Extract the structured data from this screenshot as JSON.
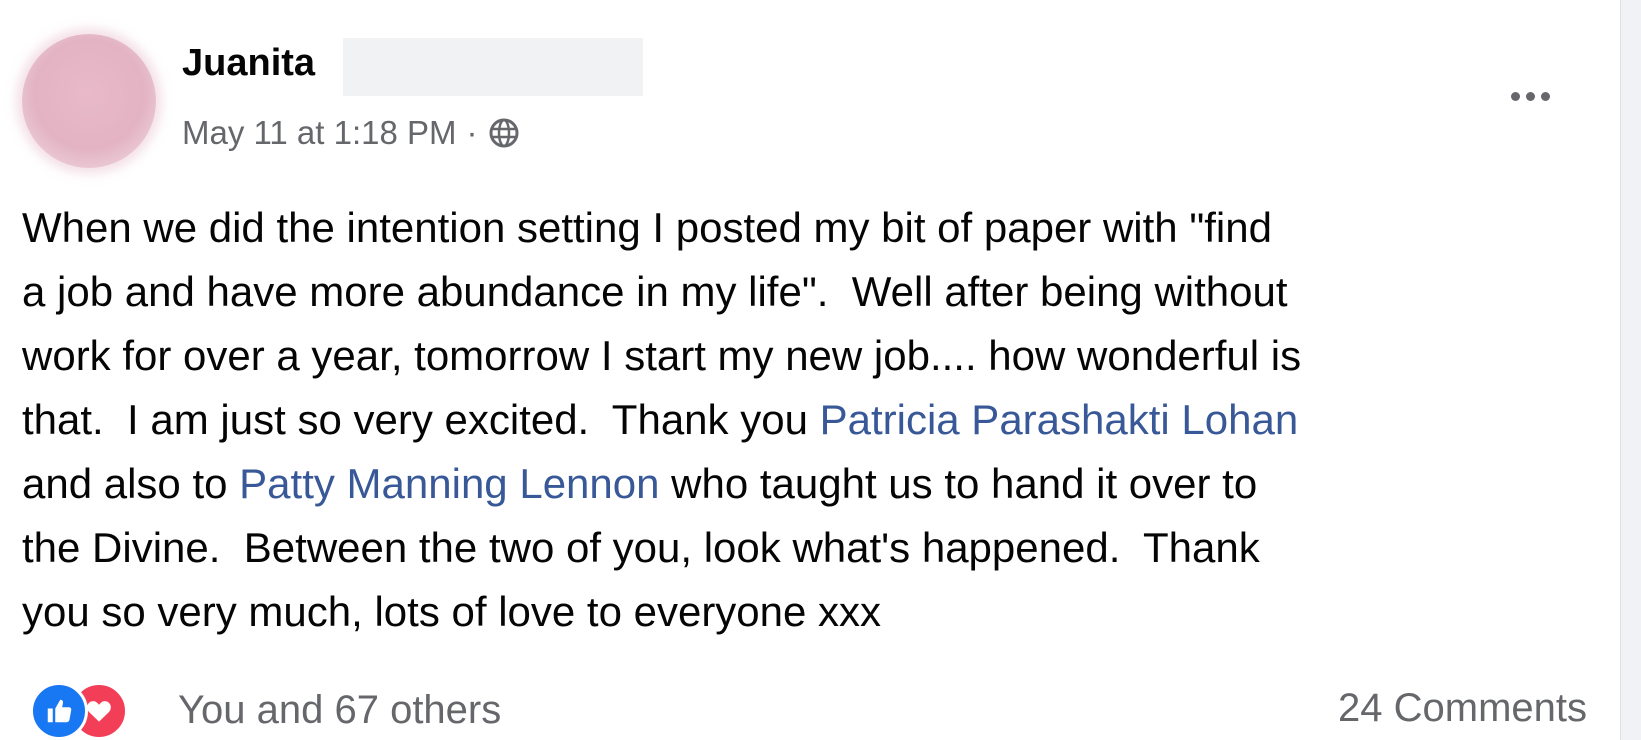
{
  "post": {
    "author": "Juanita",
    "timestamp": "May 11 at 1:18 PM",
    "separator": "·",
    "privacy_icon": "globe-icon",
    "more_icon": "more-options-icon",
    "body": {
      "line1": "When we did the intention setting I posted my bit of paper with \"find",
      "line2": "a job and have more abundance in my life\".  Well after being without",
      "line3": "work for over a year, tomorrow I start my new job.... how wonderful is",
      "line4_a": "that.  I am just so very excited.  Thank you ",
      "mention1": "Patricia Parashakti Lohan",
      "line5_a": "and also to ",
      "mention2": "Patty Manning Lennon",
      "line5_b": " who taught us to hand it over to",
      "line6": "the Divine.  Between the two of you, look what's happened.  Thank",
      "line7": "you so very much, lots of love to everyone xxx"
    },
    "reactions": {
      "icons": [
        "like-icon",
        "love-icon"
      ],
      "summary": "You and 67 others"
    },
    "comments": "24 Comments"
  },
  "colors": {
    "mention": "#385898",
    "secondary_text": "#65676b",
    "like": "#1877f2",
    "love": "#f33e58"
  }
}
